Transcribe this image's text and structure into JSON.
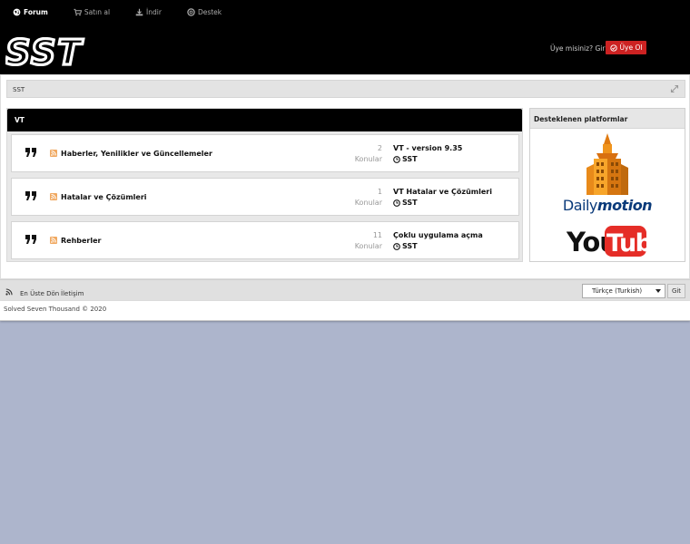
{
  "nav": {
    "items": [
      {
        "label": "Forum",
        "icon": "globe-icon"
      },
      {
        "label": "Satın al",
        "icon": "cart-icon"
      },
      {
        "label": "İndir",
        "icon": "download-icon"
      },
      {
        "label": "Destek",
        "icon": "support-icon"
      }
    ]
  },
  "header": {
    "logo_text": "SST",
    "login_text": "Üye misiniz? Giriş",
    "register_label": "Üye Ol"
  },
  "breadcrumb": {
    "label": "SST"
  },
  "forum": {
    "category_title": "VT",
    "rows": [
      {
        "title": "Haberler, Yenilikler ve Güncellemeler",
        "count": "2",
        "count_label": "Konular",
        "last_title": "VT - version 9.35",
        "last_user": "SST"
      },
      {
        "title": "Hatalar ve Çözümleri",
        "count": "1",
        "count_label": "Konular",
        "last_title": "VT Hatalar ve Çözümleri",
        "last_user": "SST"
      },
      {
        "title": "Rehberler",
        "count": "11",
        "count_label": "Konular",
        "last_title": "Çoklu uygulama açma",
        "last_user": "SST"
      }
    ]
  },
  "platforms": {
    "title": "Desteklenen platformlar",
    "dailymotion_a": "Daily",
    "dailymotion_b": "motion",
    "youtube": "YouTube"
  },
  "footer": {
    "back_to_top": "En Üste Dön",
    "contact": "İletişim",
    "language": "Türkçe (Turkish)",
    "go_label": "Git",
    "copyright": "Solved Seven Thousand © 2020"
  },
  "colors": {
    "accent_red": "#cc2222",
    "dark": "#000000",
    "page_bg": "#adb5cc"
  }
}
